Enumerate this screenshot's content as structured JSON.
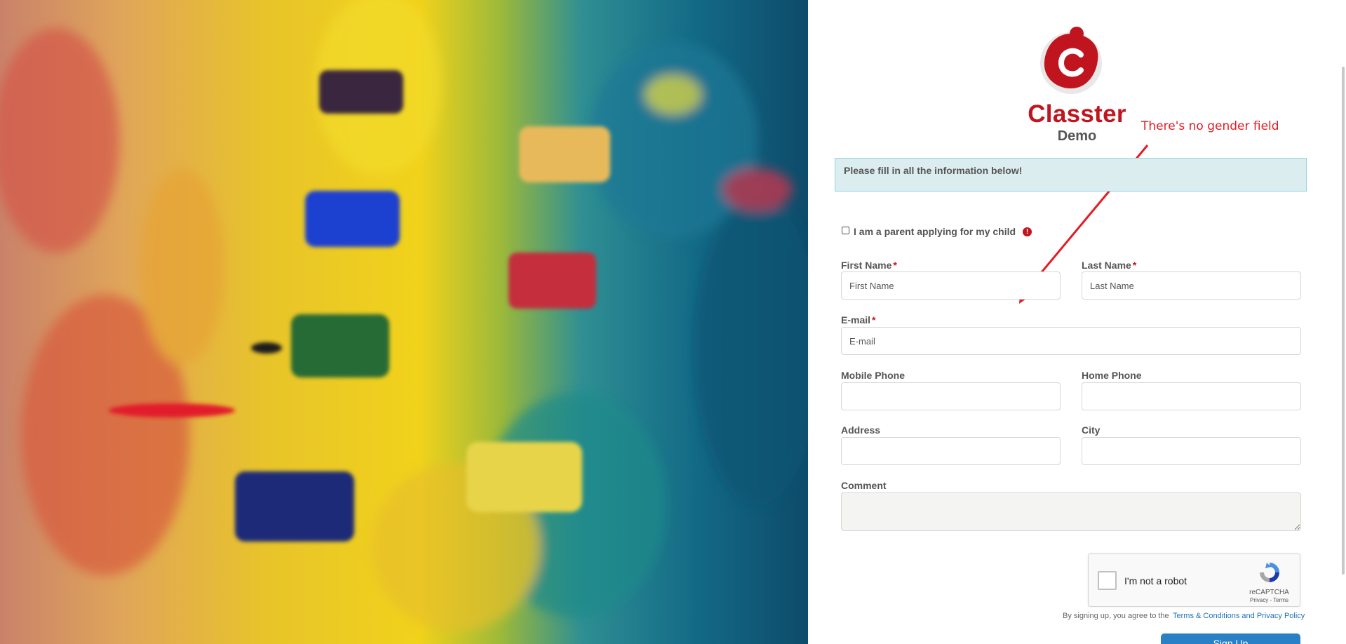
{
  "brand": {
    "name": "Classter",
    "subtitle": "Demo",
    "accent_color": "#c0151f"
  },
  "annotation": {
    "text": "There's no gender field",
    "color": "#e31c24"
  },
  "notice": {
    "text": "Please fill in all the information below!"
  },
  "parent_checkbox": {
    "label": "I am a parent applying for my child",
    "checked": false,
    "info_icon": "!"
  },
  "form": {
    "required_mark": "*",
    "first_name": {
      "label": "First Name",
      "placeholder": "First Name"
    },
    "last_name": {
      "label": "Last Name",
      "placeholder": "Last Name"
    },
    "email": {
      "label": "E-mail",
      "placeholder": "E-mail"
    },
    "mobile_phone": {
      "label": "Mobile Phone"
    },
    "home_phone": {
      "label": "Home Phone"
    },
    "address": {
      "label": "Address"
    },
    "city": {
      "label": "City"
    },
    "comment": {
      "label": "Comment"
    }
  },
  "captcha": {
    "label": "I'm not a robot",
    "brand": "reCAPTCHA",
    "links": "Privacy - Terms"
  },
  "agreement": {
    "text": "By signing up, you agree to the",
    "link_text": "Terms & Conditions and Privacy Policy"
  },
  "signup_button": {
    "label": "Sign Up"
  },
  "icons": [
    "classter-logo-icon",
    "info-icon",
    "arrow-annotation-icon",
    "recaptcha-logo-icon"
  ]
}
